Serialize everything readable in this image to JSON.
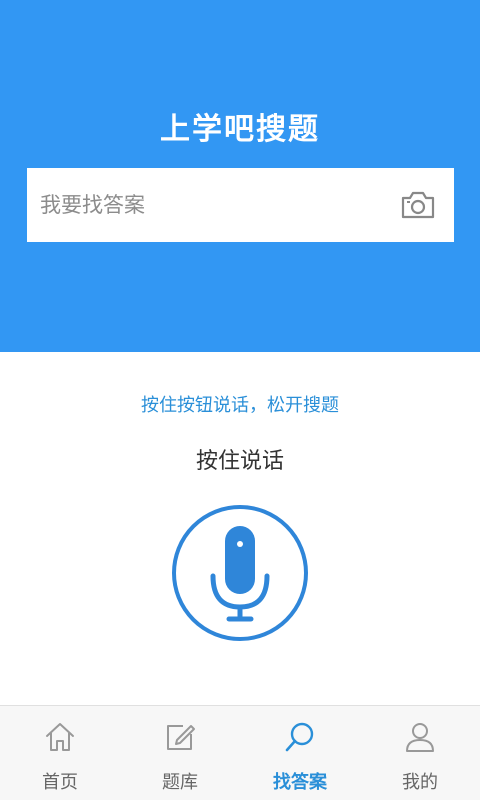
{
  "header": {
    "title": "上学吧搜题",
    "background_color": "#3297f3"
  },
  "search": {
    "placeholder": "我要找答案",
    "value": "",
    "camera_icon": "camera-icon"
  },
  "voice": {
    "hint": "按住按钮说话，松开搜题",
    "hold_label": "按住说话",
    "mic_icon": "microphone-icon",
    "accent_color": "#2f86d9"
  },
  "tabbar": {
    "active_index": 2,
    "items": [
      {
        "label": "首页",
        "icon": "home-icon"
      },
      {
        "label": "题库",
        "icon": "edit-icon"
      },
      {
        "label": "找答案",
        "icon": "search-icon"
      },
      {
        "label": "我的",
        "icon": "user-icon"
      }
    ]
  }
}
